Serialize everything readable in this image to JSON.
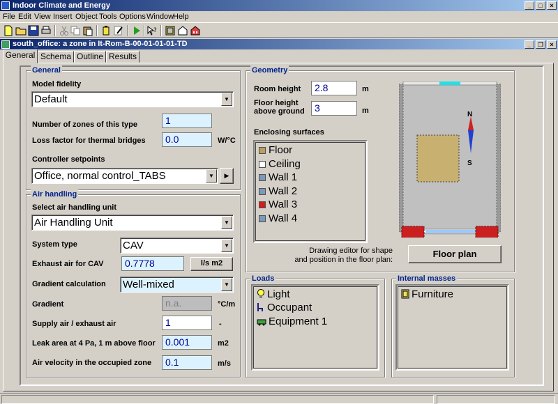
{
  "app": {
    "title": "Indoor Climate and Energy"
  },
  "menu": [
    "File",
    "Edit",
    "View",
    "Insert",
    "Object",
    "Tools",
    "Options",
    "Window",
    "Help"
  ],
  "child_window": {
    "title": "south_office: a zone in It-Rom-B-00-01-01-01-TD"
  },
  "tabs": [
    {
      "label": "General",
      "active": true
    },
    {
      "label": "Schema",
      "active": false
    },
    {
      "label": "Outline",
      "active": false
    },
    {
      "label": "Results",
      "active": false
    }
  ],
  "general": {
    "title": "General",
    "model_fidelity_label": "Model fidelity",
    "model_fidelity_value": "Default",
    "zones_label": "Number of zones of this type",
    "zones_value": "1",
    "loss_label": "Loss factor for thermal bridges",
    "loss_value": "0.0",
    "loss_unit": "W/°C",
    "controller_label": "Controller setpoints",
    "controller_value": "Office, normal control_TABS"
  },
  "air": {
    "title": "Air handling",
    "ahu_label": "Select air handling unit",
    "ahu_value": "Air Handling Unit",
    "system_label": "System type",
    "system_value": "CAV",
    "exhaust_label": "Exhaust air for CAV",
    "exhaust_value": "0.7778",
    "exhaust_unit_button": "l/s m2",
    "gradient_calc_label": "Gradient calculation",
    "gradient_calc_value": "Well-mixed",
    "gradient_label": "Gradient",
    "gradient_value": "n.a.",
    "gradient_unit": "°C/m",
    "supply_label": "Supply air / exhaust air",
    "supply_value": "1",
    "supply_unit": "-",
    "leak_label": "Leak area at 4 Pa, 1 m above floor",
    "leak_value": "0.001",
    "leak_unit": "m2",
    "velocity_label": "Air velocity in the occupied zone",
    "velocity_value": "0.1",
    "velocity_unit": "m/s"
  },
  "geometry": {
    "title": "Geometry",
    "room_height_label": "Room height",
    "room_height_value": "2.8",
    "room_height_unit": "m",
    "floor_height_label_1": "Floor height",
    "floor_height_label_2": "above ground",
    "floor_height_value": "3",
    "floor_height_unit": "m",
    "enclosing_label": "Enclosing surfaces",
    "surfaces": [
      {
        "label": "Floor",
        "swatch": "#b8a060"
      },
      {
        "label": "Ceiling",
        "swatch": "#ffffff"
      },
      {
        "label": "Wall 1",
        "swatch": "#7a9ab8"
      },
      {
        "label": "Wall 2",
        "swatch": "#7a9ab8"
      },
      {
        "label": "Wall 3",
        "swatch": "#cc2020"
      },
      {
        "label": "Wall 4",
        "swatch": "#7a9ab8"
      }
    ],
    "editor_hint_1": "Drawing editor for shape",
    "editor_hint_2": "and position in the floor plan:",
    "floor_plan_button": "Floor plan",
    "compass_n": "N",
    "compass_s": "S"
  },
  "loads": {
    "title": "Loads",
    "items": [
      "Light",
      "Occupant",
      "Equipment 1"
    ]
  },
  "internal_masses": {
    "title": "Internal masses",
    "items": [
      "Furniture"
    ]
  }
}
